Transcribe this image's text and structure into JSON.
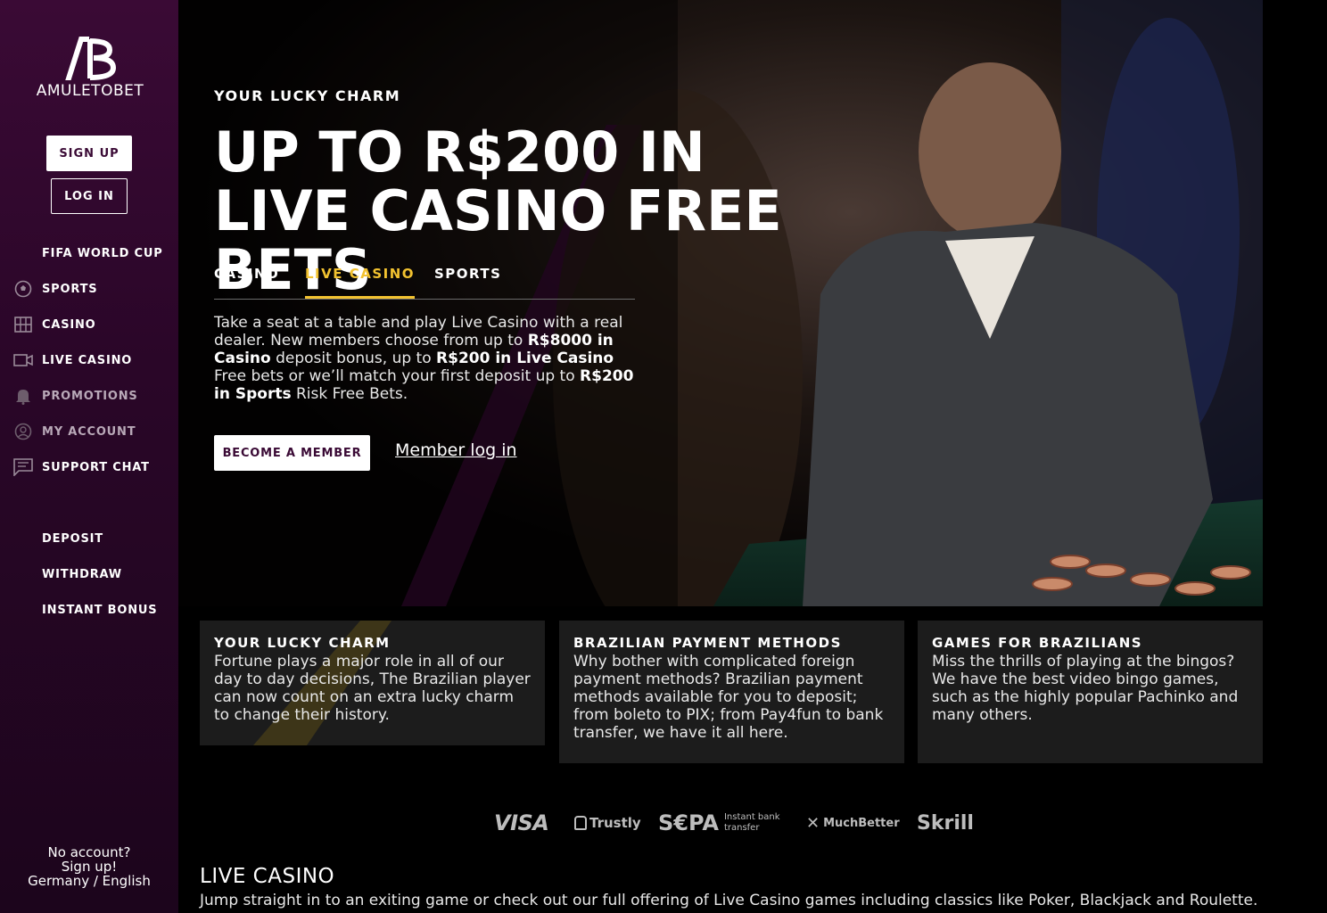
{
  "brand": {
    "name": "AMULETOBET",
    "mark": "AB"
  },
  "sidebar": {
    "signup_label": "SIGN UP",
    "login_label": "LOG IN",
    "nav": [
      {
        "label": "FIFA WORLD CUP",
        "icon": ""
      },
      {
        "label": "SPORTS",
        "icon": "soccer-ball-icon"
      },
      {
        "label": "CASINO",
        "icon": "grid-icon"
      },
      {
        "label": "LIVE CASINO",
        "icon": "video-camera-icon"
      },
      {
        "label": "PROMOTIONS",
        "icon": "bell-icon"
      },
      {
        "label": "MY ACCOUNT",
        "icon": "account-icon"
      },
      {
        "label": "SUPPORT CHAT",
        "icon": "chat-icon"
      }
    ],
    "secondary": [
      {
        "label": "DEPOSIT"
      },
      {
        "label": "WITHDRAW"
      },
      {
        "label": "INSTANT BONUS"
      }
    ],
    "footer": {
      "line1": "No account?",
      "line2": "Sign up!",
      "line3": "Germany / English"
    }
  },
  "hero": {
    "kicker": "YOUR LUCKY CHARM",
    "title": "UP TO R$200 IN LIVE CASINO FREE BETS",
    "tabs": [
      {
        "label": "CASINO",
        "active": false
      },
      {
        "label": "LIVE CASINO",
        "active": true
      },
      {
        "label": "SPORTS",
        "active": false
      }
    ],
    "desc": {
      "t1": "Take a seat at a table and play Live Casino with a real dealer. New members choose from up to ",
      "b1": "R$8000 in Casino",
      "t2": " deposit bonus, up to ",
      "b2": "R$200 in Live Casino",
      "t3": " Free bets or we’ll match your first deposit up to ",
      "b3": "R$200 in Sports",
      "t4": " Risk Free Bets."
    },
    "cta_label": "BECOME A MEMBER",
    "login_link": "Member log in"
  },
  "cards": [
    {
      "title": "YOUR LUCKY CHARM",
      "text": "Fortune plays a major role in all of our day to day decisions, The Brazilian player can now count on an extra lucky charm to change their history."
    },
    {
      "title": "BRAZILIAN PAYMENT METHODS",
      "text": "Why bother with complicated foreign payment methods? Brazilian payment methods available for you to deposit; from boleto to PIX; from Pay4fun to bank transfer, we have it all here."
    },
    {
      "title": "GAMES FOR BRAZILIANS",
      "text": "Miss the thrills of playing at the bingos? We have the best video bingo games, such as the highly popular Pachinko and many others."
    }
  ],
  "payments": {
    "visa": "VISA",
    "trustly": "Trustly",
    "sepa": "S€PA",
    "sepa_sub1": "Instant bank",
    "sepa_sub2": "transfer",
    "muchbetter": "MuchBetter",
    "skrill": "Skrill"
  },
  "section": {
    "title": "LIVE CASINO",
    "desc": "Jump straight in to an exiting game or check out our full offering of Live Casino games including classics like Poker, Blackjack and Roulette."
  },
  "colors": {
    "accent": "#f2c230",
    "brand": "#3a0a35",
    "card": "#1c1c1c"
  }
}
